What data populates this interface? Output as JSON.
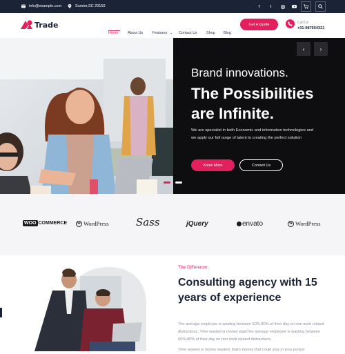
{
  "topbar": {
    "email": "info@example.com",
    "location": "Sumter,SC 29150",
    "social": [
      "f",
      "t",
      "ig",
      "yt"
    ]
  },
  "header": {
    "logo_text": "Trade",
    "nav": [
      "Home",
      "About Us",
      "Features",
      "Contact Us",
      "Shop",
      "Blog"
    ],
    "quote_button": "Get A Quote",
    "call_label": "Call Us",
    "call_number": "+01-987654321"
  },
  "hero": {
    "subtitle": "Brand innovations.",
    "title_line1": "The Possibilities",
    "title_line2": "are Infinite.",
    "description": "We are specialist in both Economic and information technologies and we apply our full range of talent to creating the perfect solution",
    "primary_button": "Know More",
    "secondary_button": "Contact Us",
    "prev_arrow": "‹",
    "next_arrow": "›"
  },
  "partners": [
    "COMMERCE",
    "WordPress",
    "Sass",
    "jQuery",
    "envato",
    "WordPress"
  ],
  "about": {
    "label": "The Difference",
    "title": "Consulting agency with 15 years of experience",
    "paragraph1": "The average employee is wasting between 50%-80% of their day on non work related distractions. Time wasted is money wastThe average employee is wasting between 50%-80% of their day on non work related distractions.",
    "paragraph2": "Time wasted is money wasted, that's money that could stay in your pocket"
  },
  "colors": {
    "accent": "#e41f5d",
    "navy": "#1b2337",
    "hero_dark": "#0e0e10"
  }
}
